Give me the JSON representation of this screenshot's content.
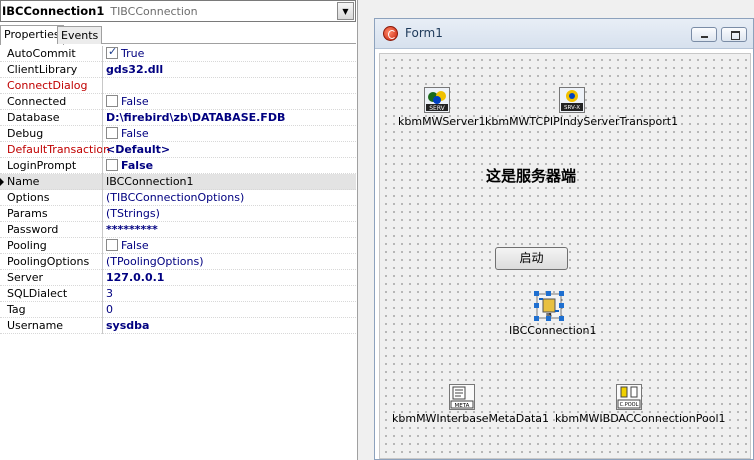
{
  "inspector": {
    "component_name": "IBCConnection1",
    "component_type": "TIBCConnection",
    "tabs": [
      {
        "label": "Properties"
      },
      {
        "label": "Events"
      }
    ],
    "properties": [
      {
        "name": "AutoCommit",
        "value": "True"
      },
      {
        "name": "ClientLibrary",
        "value": "gds32.dll"
      },
      {
        "name": "ConnectDialog",
        "value": ""
      },
      {
        "name": "Connected",
        "value": "False"
      },
      {
        "name": "Database",
        "value": "D:\\firebird\\zb\\DATABASE.FDB"
      },
      {
        "name": "Debug",
        "value": "False"
      },
      {
        "name": "DefaultTransaction",
        "value": "<Default>"
      },
      {
        "name": "LoginPrompt",
        "value": "False"
      },
      {
        "name": "Name",
        "value": "IBCConnection1"
      },
      {
        "name": "Options",
        "value": "(TIBCConnectionOptions)"
      },
      {
        "name": "Params",
        "value": "(TStrings)"
      },
      {
        "name": "Password",
        "value": "*********"
      },
      {
        "name": "Pooling",
        "value": "False"
      },
      {
        "name": "PoolingOptions",
        "value": "(TPoolingOptions)"
      },
      {
        "name": "Server",
        "value": "127.0.0.1"
      },
      {
        "name": "SQLDialect",
        "value": "3"
      },
      {
        "name": "Tag",
        "value": "0"
      },
      {
        "name": "Username",
        "value": "sysdba"
      }
    ]
  },
  "form": {
    "title": "Form1",
    "heading": "这是服务器端",
    "start_button": "启动",
    "components": [
      {
        "label": "kbmMWServer1",
        "icon_text": "SERV"
      },
      {
        "label": "kbmMWTCPIPIndyServerTransport1",
        "icon_text": "SRV-X"
      },
      {
        "label": "IBCConnection1",
        "icon_text": "IB"
      },
      {
        "label": "kbmMWInterbaseMetaData1",
        "icon_text": "META"
      },
      {
        "label": "kbmMWIBDACConnectionPool1",
        "icon_text": "C.POOL"
      }
    ]
  },
  "colors": {
    "value_text": "#000080",
    "required_name": "#c00000",
    "form_border": "#8da2bd"
  }
}
